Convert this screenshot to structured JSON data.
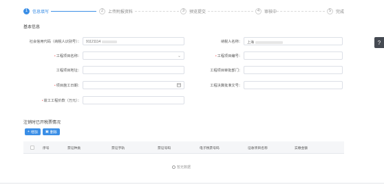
{
  "steps": [
    {
      "num": "1",
      "label": "信息填写",
      "active": true
    },
    {
      "num": "2",
      "label": "上传附报资料",
      "active": false
    },
    {
      "num": "3",
      "label": "预览提交",
      "active": false
    },
    {
      "num": "4",
      "label": "审核中",
      "active": false
    },
    {
      "num": "5",
      "label": "完成",
      "active": false
    }
  ],
  "section_basic": "基本信息",
  "fields": {
    "credit_code": {
      "label": "社会信用代码（纳税人识别号）：",
      "value": "91121114",
      "required": false
    },
    "taxpayer_name": {
      "label": "纳税人名称：",
      "value": "上海",
      "required": false
    },
    "project_name": {
      "label": "工程项目名称：",
      "value": "",
      "required": true
    },
    "project_no": {
      "label": "工程项目编号：",
      "value": "",
      "required": true
    },
    "project_address": {
      "label": "工程项目地址：",
      "value": "",
      "required": false
    },
    "project_unit": {
      "label": "工程项目审批部门：",
      "value": "",
      "required": false
    },
    "start_date": {
      "label": "项目施工日期：",
      "value": "",
      "required": true
    },
    "approval_doc": {
      "label": "工程决算批准文号：",
      "value": "",
      "required": false
    },
    "amount": {
      "label": "竣工工程价款（万元）：",
      "value": "",
      "required": true
    }
  },
  "section_invoice": "注销时已开税票情况",
  "buttons": {
    "add": "增加",
    "delete": "删除"
  },
  "table_headers": [
    "序号",
    "票证种类",
    "票证字轨",
    "票证号码",
    "电子税票号码",
    "征收项目名称",
    "实缴金额"
  ],
  "empty_text": "暂无数据",
  "colors": {
    "accent": "#3a8ee6",
    "required": "#f56c6c"
  }
}
